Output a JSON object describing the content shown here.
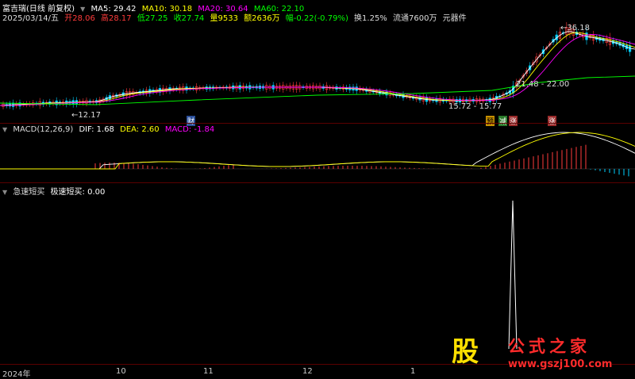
{
  "price_panel": {
    "stock_name": "富吉瑞(日线 前复权)",
    "ma5": "MA5: 29.42",
    "ma10": "MA10: 30.18",
    "ma20": "MA20: 30.64",
    "ma60": "MA60: 22.10",
    "date": "2025/03/14/五",
    "open": "开28.06",
    "high": "高28.17",
    "low": "低27.25",
    "close": "收27.74",
    "volume": "量9533",
    "amount": "额2636万",
    "change": "幅-0.22(-0.79%)",
    "turnover": "换1.25%",
    "float": "流通7600万",
    "sector": "元器件",
    "price_high_label": "36.18",
    "price_low_label": "12.17",
    "range_label_1": "15.72 - 15.77",
    "range_label_2": "21.48 - 22.00",
    "markers": {
      "cai": "财",
      "yu": "预",
      "jian": "减",
      "zhang": "涨",
      "zhang2": "涨"
    }
  },
  "macd_panel": {
    "title": "MACD(12,26,9)",
    "dif": "DIF: 1.68",
    "dea": "DEA: 2.60",
    "macd": "MACD: -1.84"
  },
  "signal_panel": {
    "title": "急速短买",
    "value": "极速短买: 0.00"
  },
  "x_axis": {
    "labels": [
      "2024年",
      "10",
      "11",
      "12",
      "1"
    ]
  },
  "watermark": {
    "logo_char": "股",
    "site_name": "公式之家",
    "url": "www.gszj100.com"
  },
  "colors": {
    "up": "#ff3b3b",
    "down": "#00d0ff",
    "ma5": "#ffffff",
    "ma10": "#ffff00",
    "ma20": "#ff00ff",
    "ma60": "#00ff00",
    "panel_line": "#5a0000"
  }
}
